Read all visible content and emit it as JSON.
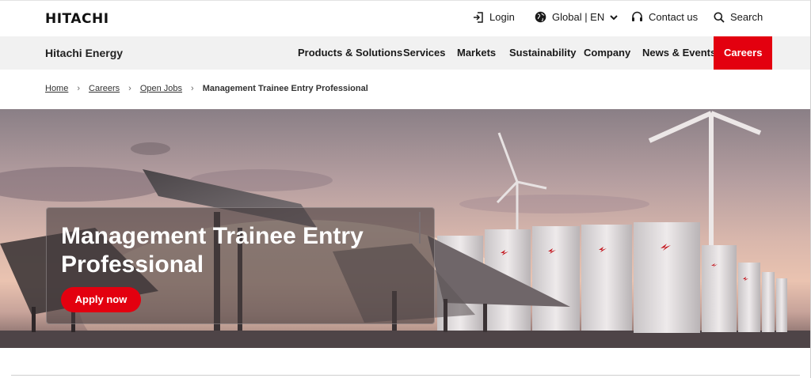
{
  "header": {
    "logo": "HITACHI",
    "login_label": "Login",
    "region_label": "Global | EN",
    "contact_label": "Contact us",
    "search_label": "Search"
  },
  "nav": {
    "brand": "Hitachi Energy",
    "items": [
      {
        "label": "Products & Solutions"
      },
      {
        "label": "Services"
      },
      {
        "label": "Markets"
      },
      {
        "label": "Sustainability"
      },
      {
        "label": "Company"
      },
      {
        "label": "News & Events"
      },
      {
        "label": "Careers",
        "active": true
      }
    ]
  },
  "breadcrumb": {
    "home": "Home",
    "careers": "Careers",
    "open_jobs": "Open Jobs",
    "current": "Management Trainee Entry Professional",
    "separator": "›"
  },
  "hero": {
    "title": "Management Trainee Entry Professional",
    "apply_label": "Apply now"
  },
  "colors": {
    "accent": "#e3000f",
    "nav_bg": "#f1f1f1"
  }
}
